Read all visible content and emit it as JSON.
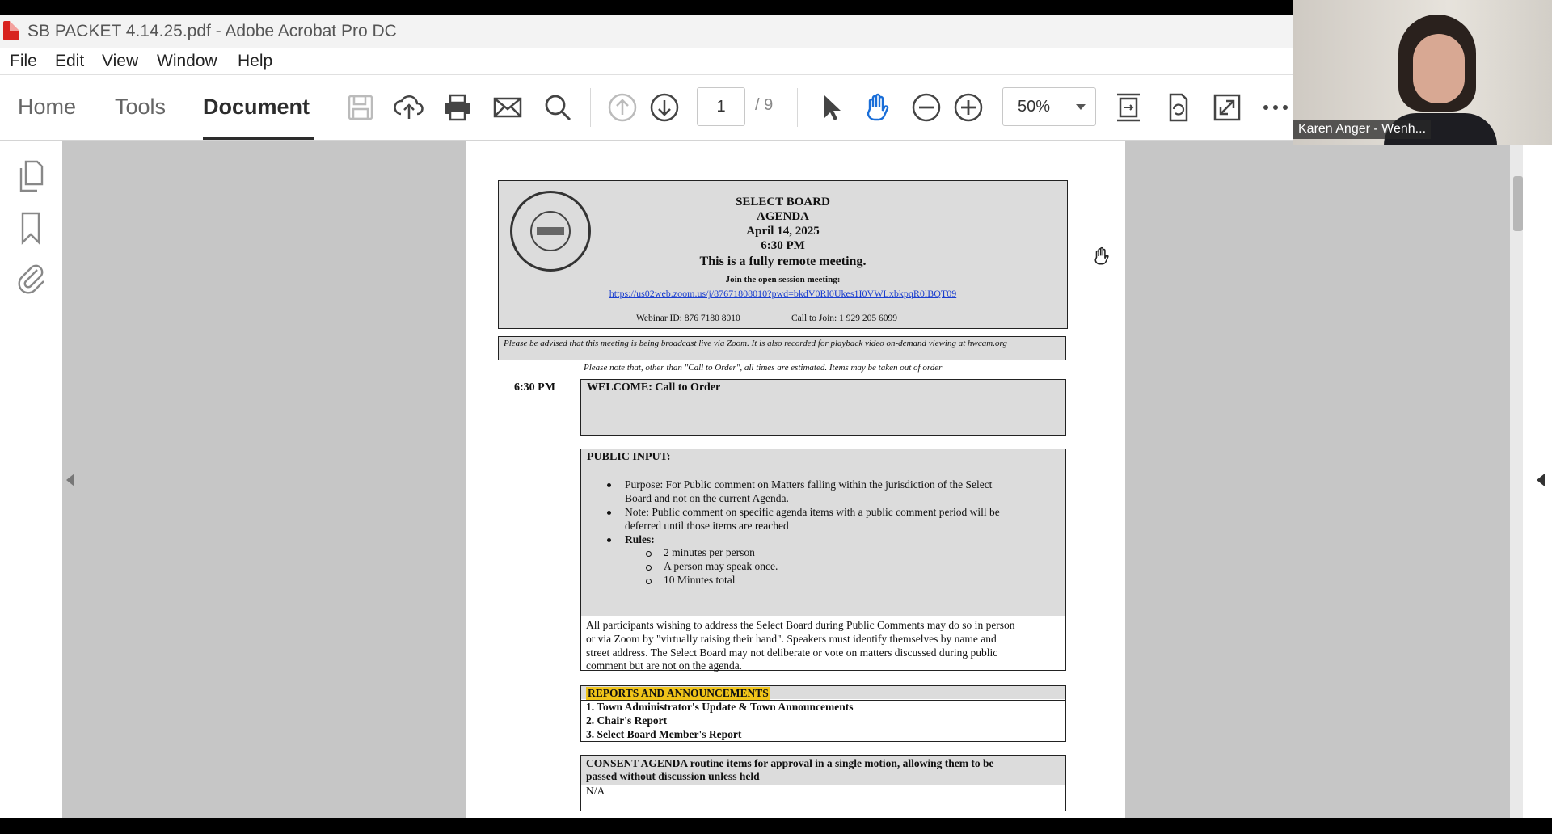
{
  "window": {
    "title": "SB PACKET 4.14.25.pdf - Adobe Acrobat Pro DC"
  },
  "menu": [
    "File",
    "Edit",
    "View",
    "Window",
    "Help"
  ],
  "tabs": [
    "Home",
    "Tools",
    "Document"
  ],
  "toolbar": {
    "current_page": "1",
    "total_pages": "/ 9",
    "zoom": "50%"
  },
  "icons": {
    "toolbar": [
      "save-icon",
      "upload-icon",
      "print-icon",
      "email-icon",
      "search-icon",
      "page-up-icon",
      "page-down-icon",
      "select-cursor-icon",
      "hand-tool-icon",
      "zoom-out-icon",
      "zoom-in-icon",
      "fit-page-icon",
      "rotate-icon",
      "full-screen-icon",
      "more-icon"
    ],
    "left_panel": [
      "page-thumbnails-icon",
      "bookmark-icon",
      "attachment-icon"
    ]
  },
  "document": {
    "header": {
      "line1": "SELECT BOARD",
      "line2": "AGENDA",
      "line3": "April 14, 2025",
      "line4": "6:30 PM",
      "line5": "This is a fully remote meeting.",
      "line6": "Join the open session meeting:",
      "link": "https://us02web.zoom.us/j/87671808010?pwd=bkdV0Rl0Ukes1I0VWLxbkpqR0lBQT09",
      "webinar": "Webinar ID: 876 7180 8010",
      "call_to_join": "Call to Join:   1 929 205 6099"
    },
    "notice": "Please be advised that this meeting is being broadcast live via Zoom. It is also recorded for playback video on-demand viewing at hwcam.org",
    "estimate_note": "Please note that, other than \"Call to Order\", all times are estimated. Items may be taken out of order",
    "sections": {
      "welcome": {
        "time": "6:30 PM",
        "title": "WELCOME:  Call to Order"
      },
      "public_input": {
        "title": "PUBLIC INPUT:",
        "purpose_1": "Purpose: For Public comment on Matters falling within the jurisdiction of the Select",
        "purpose_2": "Board and not on the current Agenda.",
        "note_1": "Note: Public comment on specific agenda items with a public comment period will be",
        "note_2": "deferred until those items are reached",
        "rules": "Rules:",
        "rule_1": "2 minutes per person",
        "rule_2": "A person may speak once.",
        "rule_3": "10 Minutes total",
        "para_1": "All participants wishing to address the Select Board during Public Comments may do so in person",
        "para_2": "or via Zoom by \"virtually raising their hand\". Speakers must identify themselves by name and",
        "para_3": "street address. The Select Board may not deliberate or vote on matters discussed during public",
        "para_4": "comment but are not on the agenda."
      },
      "reports": {
        "title": "REPORTS AND ANNOUNCEMENTS",
        "item_1": "1.  Town Administrator's Update & Town Announcements",
        "item_2": "2.  Chair's Report",
        "item_3": "3.  Select Board Member's Report"
      },
      "consent": {
        "title_1": "CONSENT AGENDA  routine items for approval in a single motion, allowing them to be",
        "title_2": "passed without discussion unless held",
        "value": "N/A"
      }
    }
  },
  "webcam": {
    "participant": "Karen Anger - Wenh..."
  },
  "colors": {
    "highlight": "#f0c419",
    "link": "#1a3ecf"
  }
}
